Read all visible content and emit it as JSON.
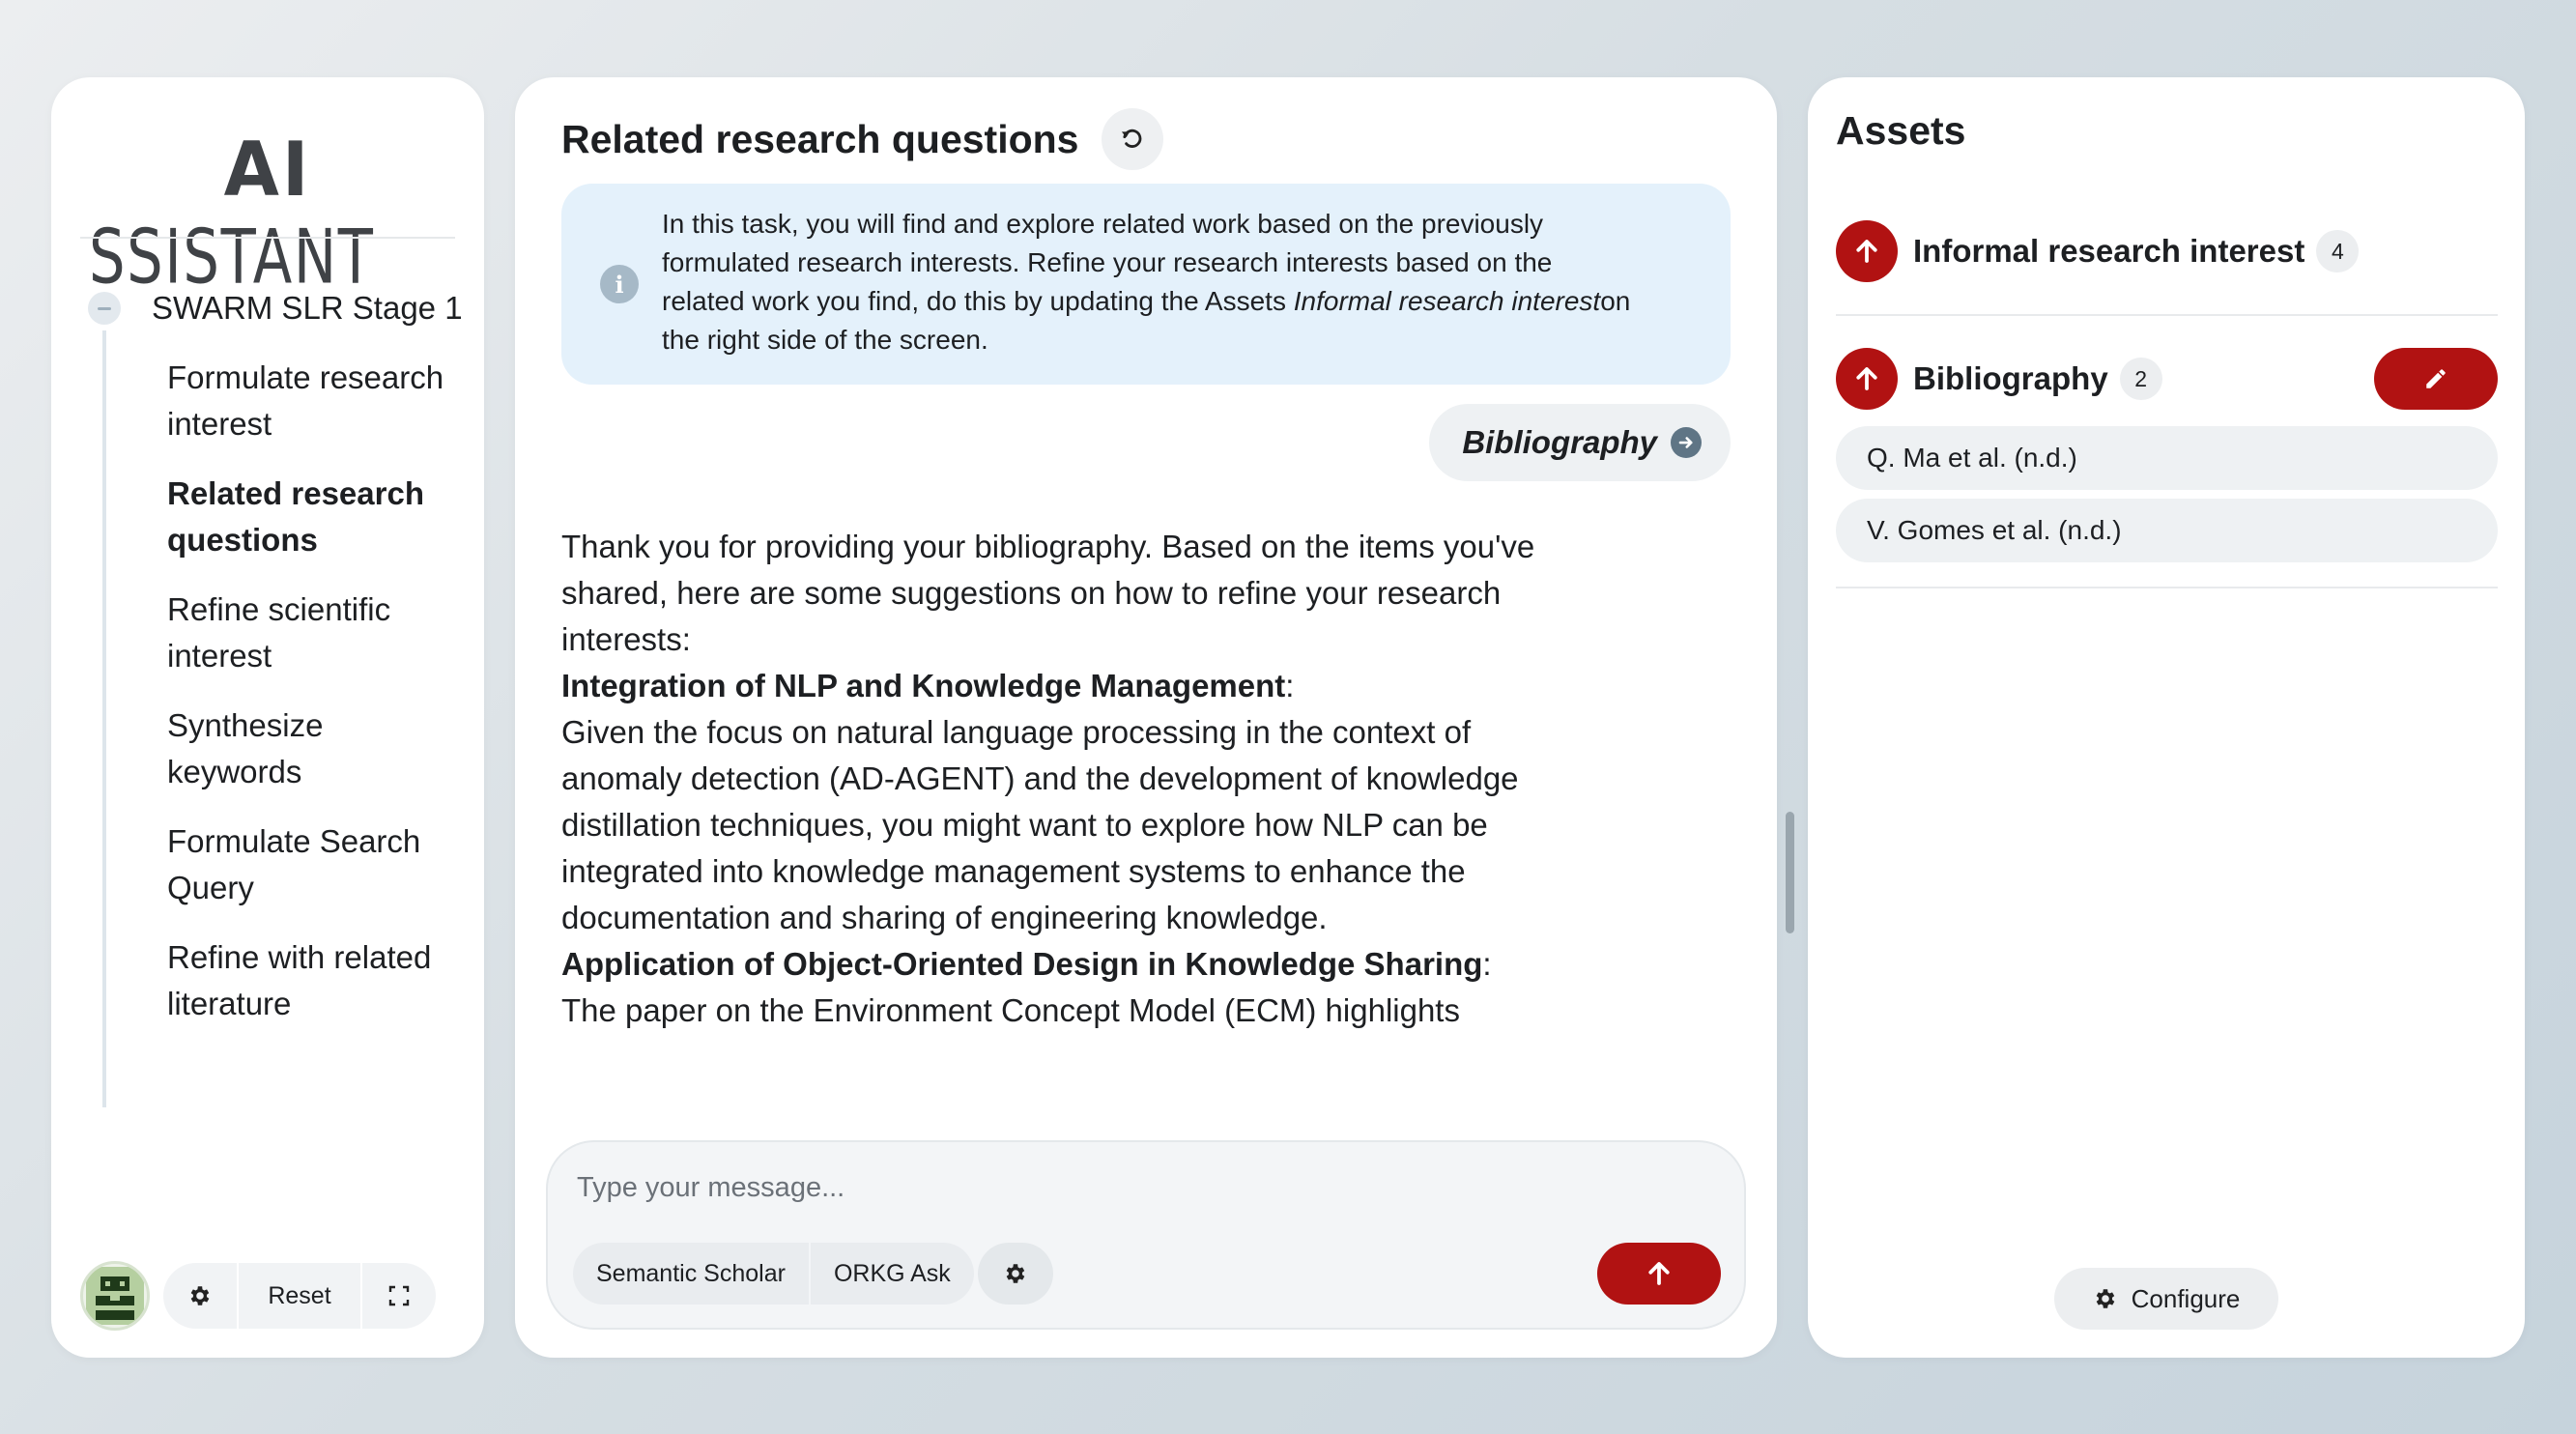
{
  "app": {
    "logo_ai": "AI",
    "logo_rest": "SSISTANT"
  },
  "sidebar": {
    "stage_title": "SWARM SLR Stage 1",
    "steps": [
      {
        "label": "Formulate research interest",
        "active": false
      },
      {
        "label": "Related research questions",
        "active": true
      },
      {
        "label": "Refine scientific interest",
        "active": false
      },
      {
        "label": "Synthesize keywords",
        "active": false
      },
      {
        "label": "Formulate Search Query",
        "active": false
      },
      {
        "label": "Refine with related literature",
        "active": false
      }
    ],
    "footer": {
      "reset_label": "Reset"
    }
  },
  "main": {
    "title": "Related research questions",
    "info": {
      "text_before": "In this task, you will find and explore related work based on the previously formulated research interests. Refine your research interests based on the related work you find, do this by updating the Assets ",
      "text_italic": "Informal research interest",
      "text_after": "on the right side of the screen."
    },
    "chip_label": "Bibliography",
    "message": {
      "intro": "Thank you for providing your bibliography. Based on the items you've shared, here are some suggestions on how to refine your research interests:",
      "heading1": "Integration of NLP and Knowledge Management",
      "body1": "Given the focus on natural language processing in the context of anomaly detection (AD-AGENT) and the development of knowledge distillation techniques, you might want to explore how NLP can be integrated into knowledge management systems to enhance the documentation and sharing of engineering knowledge.",
      "heading2": "Application of Object-Oriented Design in Knowledge Sharing",
      "body2": "The paper on the Environment Concept Model (ECM) highlights",
      "colon": ":"
    },
    "composer": {
      "placeholder": "Type your message...",
      "tools": [
        "Semantic Scholar",
        "ORKG Ask"
      ]
    }
  },
  "assets": {
    "title": "Assets",
    "items": [
      {
        "name": "Informal research interest",
        "count": "4"
      },
      {
        "name": "Bibliography",
        "count": "2"
      }
    ],
    "bibliography_entries": [
      "Q. Ma et al. (n.d.)",
      "V. Gomes et al. (n.d.)"
    ],
    "configure_label": "Configure"
  },
  "colors": {
    "accent": "#b11212",
    "info_bg": "#e4f1fb"
  }
}
